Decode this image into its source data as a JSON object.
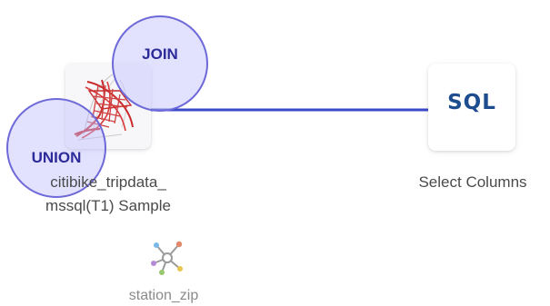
{
  "canvas": {
    "nodes": [
      {
        "id": "source",
        "label_line1": "citibike_tripdata_",
        "label_line2": "mssql(T1) Sample",
        "icon": "sql-server-icon"
      },
      {
        "id": "sql",
        "label": "Select Columns",
        "icon_text": "SQL"
      }
    ],
    "badges": {
      "join": "JOIN",
      "union": "UNION"
    },
    "sub_node": {
      "label": "station_zip",
      "icon": "network-hub-icon"
    }
  },
  "colors": {
    "edge": "#3a49c8",
    "sql_text": "#1d4d8f",
    "badge_fill": "rgba(190,190,255,0.45)",
    "badge_stroke": "#6e69d8",
    "badge_text": "#2d2a9a"
  }
}
